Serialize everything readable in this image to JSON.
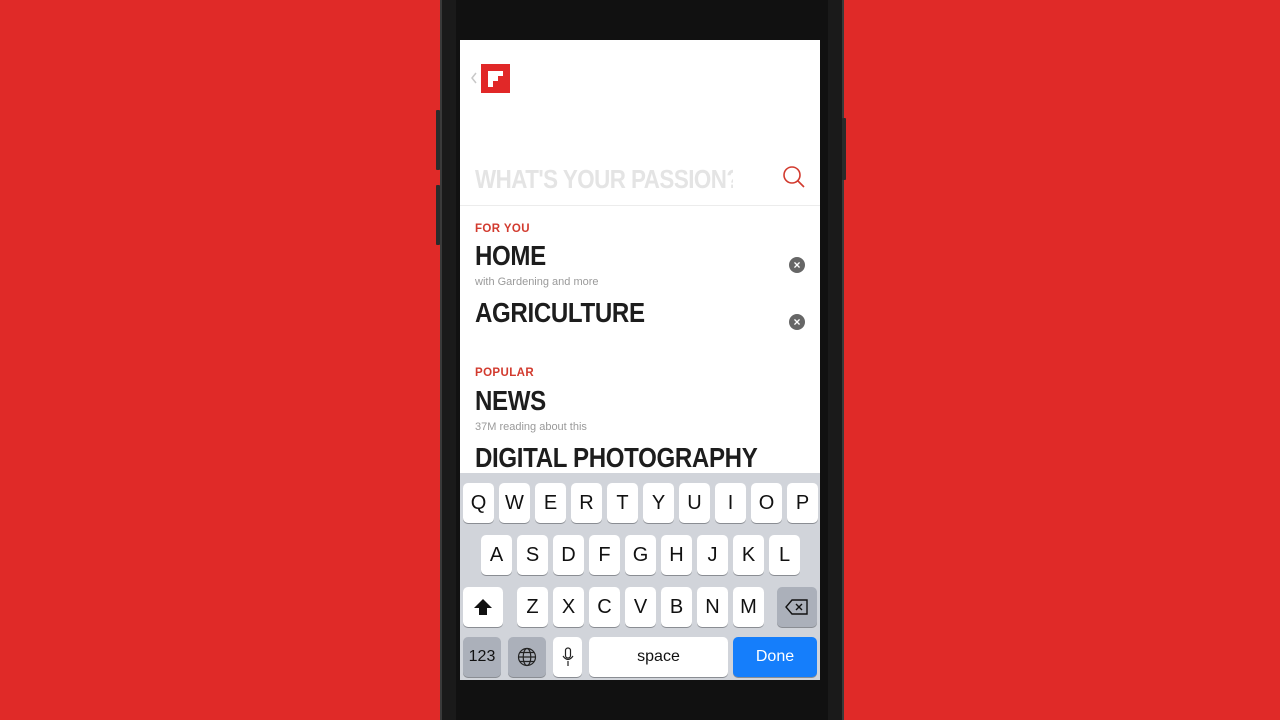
{
  "app": {
    "search": {
      "placeholder": "WHAT'S YOUR PASSION?"
    }
  },
  "sections": {
    "for_you": {
      "label": "FOR YOU",
      "items": [
        {
          "title": "HOME",
          "subtitle": "with Gardening and more"
        },
        {
          "title": "AGRICULTURE",
          "subtitle": ""
        }
      ]
    },
    "popular": {
      "label": "POPULAR",
      "items": [
        {
          "title": "NEWS",
          "subtitle": "37M reading about this"
        },
        {
          "title": "DIGITAL PHOTOGRAPHY",
          "subtitle": ""
        }
      ]
    }
  },
  "keyboard": {
    "row1": [
      "Q",
      "W",
      "E",
      "R",
      "T",
      "Y",
      "U",
      "I",
      "O",
      "P"
    ],
    "row2": [
      "A",
      "S",
      "D",
      "F",
      "G",
      "H",
      "J",
      "K",
      "L"
    ],
    "row3": [
      "Z",
      "X",
      "C",
      "V",
      "B",
      "N",
      "M"
    ],
    "numbers_label": "123",
    "space_label": "space",
    "done_label": "Done"
  },
  "colors": {
    "background": "#e02a28",
    "accent": "#d23a2e",
    "done_key": "#157efb"
  },
  "icons": [
    "back-chevron-icon",
    "flipboard-logo",
    "search-icon",
    "close-icon",
    "shift-icon",
    "backspace-icon",
    "globe-icon",
    "microphone-icon"
  ]
}
